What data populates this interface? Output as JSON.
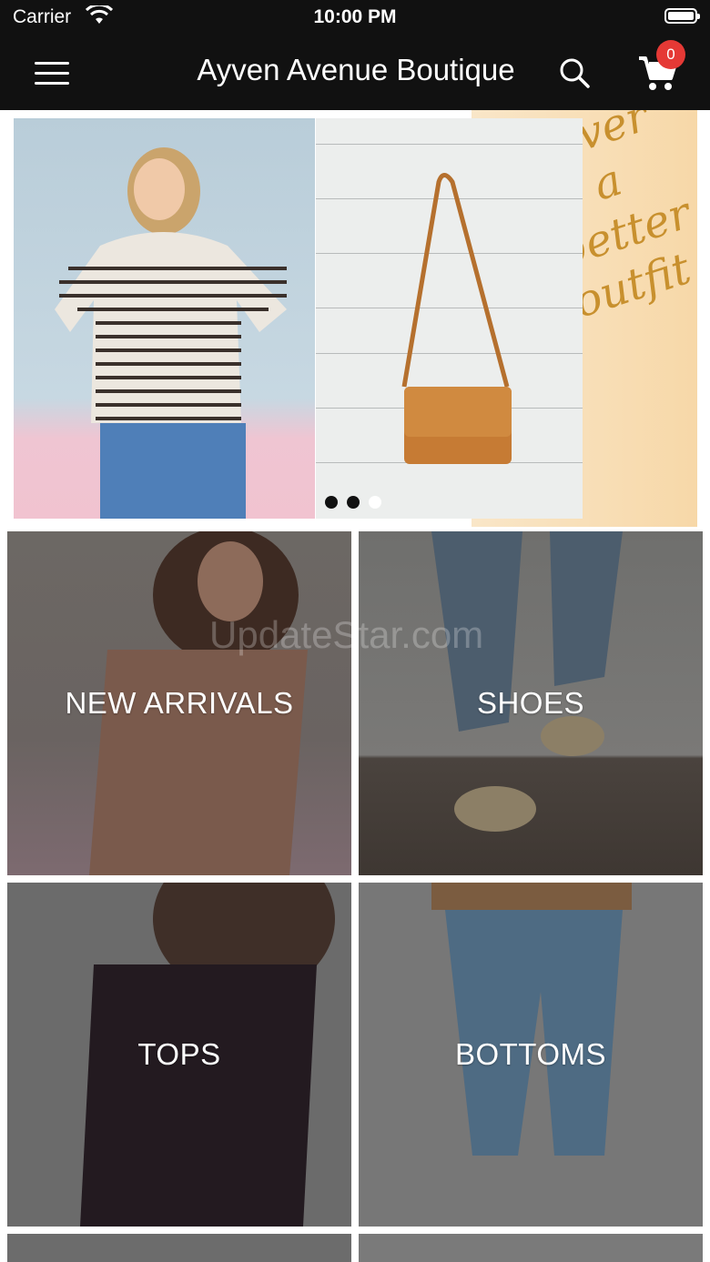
{
  "status_bar": {
    "carrier": "Carrier",
    "time": "10:00 PM"
  },
  "header": {
    "title": "Ayven Avenue Boutique",
    "cart_count": "0"
  },
  "hero": {
    "paper_text": [
      "never",
      "a",
      "better",
      "outfit"
    ],
    "active_dot_index": 0
  },
  "categories": [
    {
      "label": "NEW ARRIVALS"
    },
    {
      "label": "SHOES"
    },
    {
      "label": "TOPS"
    },
    {
      "label": "BOTTOMS"
    }
  ],
  "watermark": "UpdateStar.com",
  "colors": {
    "header_bg": "#111111",
    "badge": "#e53935"
  }
}
